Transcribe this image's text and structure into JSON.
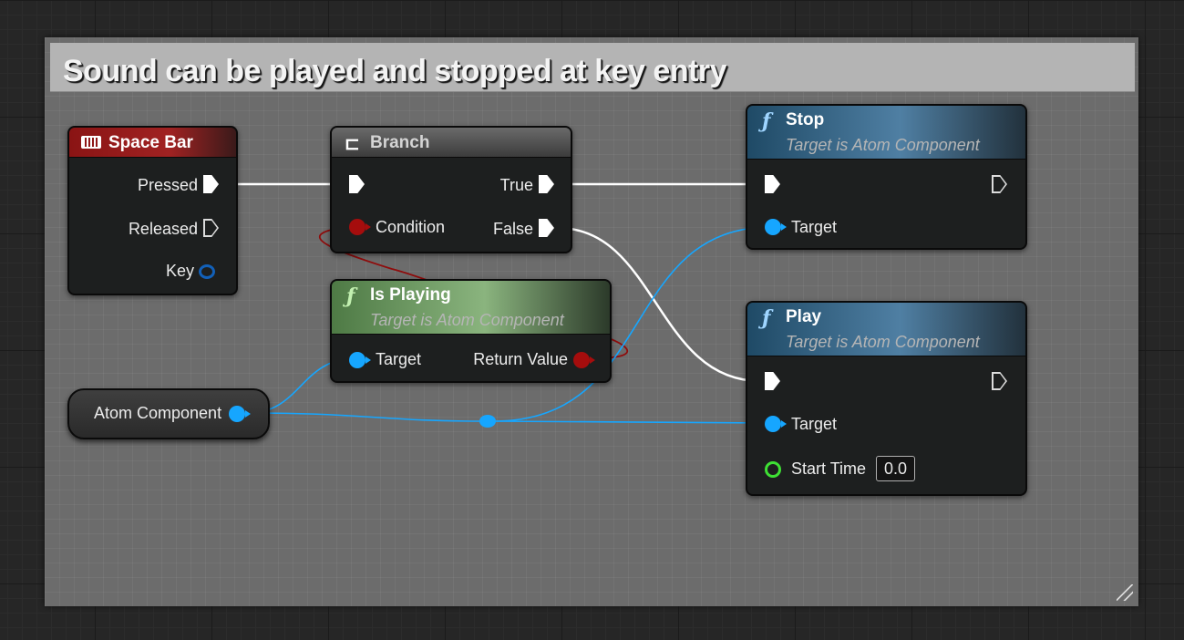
{
  "comment": {
    "title": "Sound can be played and stopped at key entry"
  },
  "colors": {
    "exec_wire": "#ffffff",
    "object_pin": "#16a6ff",
    "bool_pin": "#a50d0d",
    "float_pin": "#3ee034",
    "input_event_header": "#8a1414",
    "function_header": "#2d5a7a",
    "pure_function_header": "#557a47",
    "branch_header": "#5a5a5a"
  },
  "nodes": {
    "space_bar": {
      "title": "Space Bar",
      "icon": "keyboard-icon",
      "pins": {
        "pressed": "Pressed",
        "released": "Released",
        "key": "Key"
      }
    },
    "branch": {
      "title": "Branch",
      "icon": "branch-icon",
      "pins": {
        "condition": "Condition",
        "true": "True",
        "false": "False"
      }
    },
    "stop": {
      "title": "Stop",
      "subtitle": "Target is Atom Component",
      "icon": "function-icon",
      "pins": {
        "target": "Target"
      }
    },
    "play": {
      "title": "Play",
      "subtitle": "Target is Atom Component",
      "icon": "function-icon",
      "pins": {
        "target": "Target",
        "start_time": "Start Time",
        "start_time_value": "0.0"
      }
    },
    "is_playing": {
      "title": "Is Playing",
      "subtitle": "Target is Atom Component",
      "icon": "function-icon",
      "pins": {
        "target": "Target",
        "return_value": "Return Value"
      }
    },
    "atom_component": {
      "label": "Atom Component"
    }
  }
}
